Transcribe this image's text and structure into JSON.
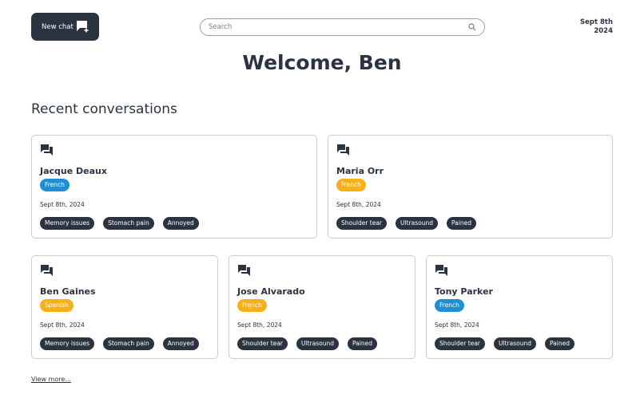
{
  "header": {
    "new_chat_label": "New chat",
    "search_placeholder": "Search",
    "date_line1": "Sept 8th",
    "date_line2": "2024"
  },
  "welcome": "Welcome, Ben",
  "section_title": "Recent conversations",
  "conversations": [
    {
      "name": "Jacque Deaux",
      "language": "French",
      "language_color": "#1f8fd1",
      "date": "Sept 8th, 2024",
      "tags": [
        "Memory issues",
        "Stomach pain",
        "Annoyed"
      ]
    },
    {
      "name": "Maria Orr",
      "language": "French",
      "language_color": "#f7b016",
      "date": "Sept 8th, 2024",
      "tags": [
        "Shoulder tear",
        "Ultrasound",
        "Pained"
      ]
    },
    {
      "name": "Ben Gaines",
      "language": "Spanish",
      "language_color": "#f7b016",
      "date": "Sept 8th, 2024",
      "tags": [
        "Memory issues",
        "Stomach pain",
        "Annoyed"
      ]
    },
    {
      "name": "Jose Alvarado",
      "language": "French",
      "language_color": "#f7b016",
      "date": "Sept 8th, 2024",
      "tags": [
        "Shoulder tear",
        "Ultrasound",
        "Pained"
      ]
    },
    {
      "name": "Tony Parker",
      "language": "French",
      "language_color": "#1f8fd1",
      "date": "Sept 8th, 2024",
      "tags": [
        "Shoulder tear",
        "Ultrasound",
        "Pained"
      ]
    }
  ],
  "view_more": "View more..."
}
